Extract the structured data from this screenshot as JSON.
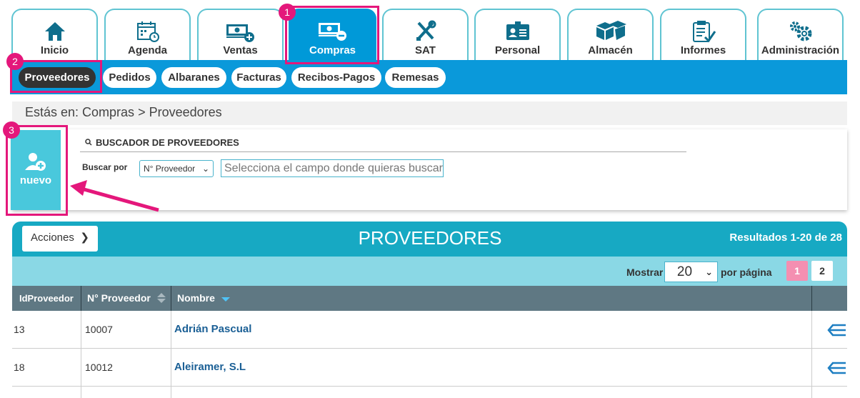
{
  "modules": [
    {
      "label": "Inicio",
      "icon": "home-icon"
    },
    {
      "label": "Agenda",
      "icon": "calendar-icon"
    },
    {
      "label": "Ventas",
      "icon": "money-plus-icon"
    },
    {
      "label": "Compras",
      "icon": "money-minus-icon",
      "active": true
    },
    {
      "label": "SAT",
      "icon": "tools-icon"
    },
    {
      "label": "Personal",
      "icon": "id-card-icon"
    },
    {
      "label": "Almacén",
      "icon": "boxes-icon"
    },
    {
      "label": "Informes",
      "icon": "clipboard-icon"
    },
    {
      "label": "Administración",
      "icon": "gears-icon"
    }
  ],
  "submenu": [
    {
      "label": "Proveedores",
      "active": true
    },
    {
      "label": "Pedidos"
    },
    {
      "label": "Albaranes"
    },
    {
      "label": "Facturas"
    },
    {
      "label": "Recibos-Pagos"
    },
    {
      "label": "Remesas"
    }
  ],
  "breadcrumb": "Estás en: Compras > Proveedores",
  "new_button": {
    "label": "nuevo",
    "icon": "add-user-icon"
  },
  "search": {
    "title": "BUSCADOR DE PROVEEDORES",
    "label": "Buscar por",
    "selected_field": "N° Proveedor",
    "placeholder": "Selecciona el campo donde quieras buscar"
  },
  "list": {
    "actions_label": "Acciones",
    "title": "PROVEEDORES",
    "results": "Resultados 1-20 de 28",
    "show_label": "Mostrar",
    "per_page": "20",
    "per_page_suffix": "por página",
    "pages": [
      "1",
      "2"
    ],
    "current_page": "1",
    "columns": [
      "IdProveedor",
      "N° Proveedor",
      "Nombre"
    ],
    "rows": [
      {
        "id": "13",
        "number": "10007",
        "name": "Adrián Pascual"
      },
      {
        "id": "18",
        "number": "10012",
        "name": "Aleiramer, S.L"
      }
    ]
  },
  "annotations": [
    "1",
    "2",
    "3"
  ],
  "colors": {
    "primary": "#0a99da",
    "teal": "#17a9c3",
    "light_teal": "#8ad8e5",
    "new_button": "#49c8dc",
    "header_gray": "#5f7883",
    "highlight": "#e4177b"
  }
}
